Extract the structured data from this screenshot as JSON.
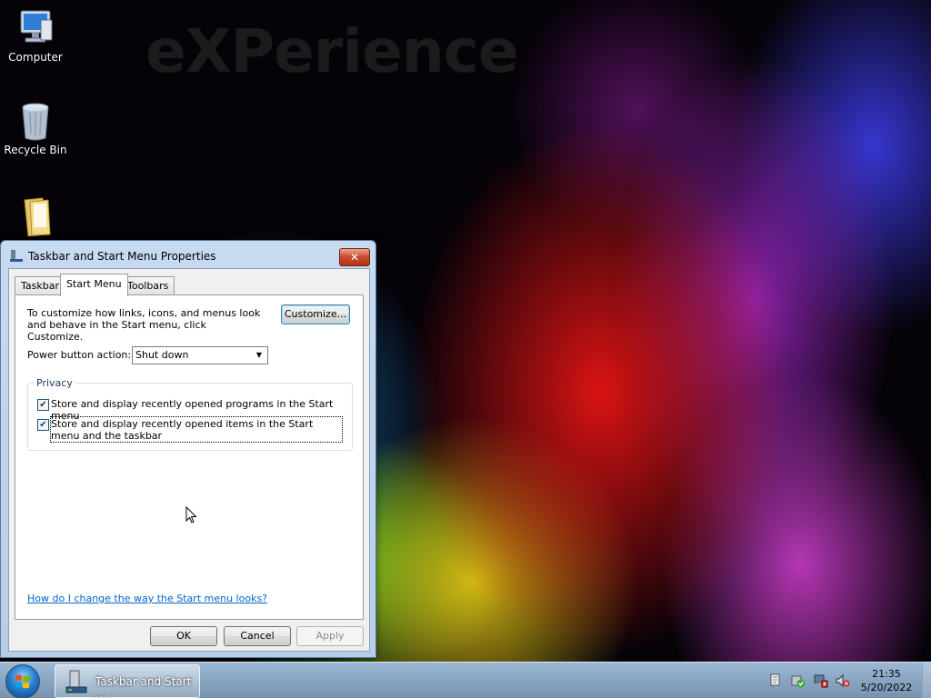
{
  "wallpaper": {
    "text": "eXPerience"
  },
  "desktop_icons": [
    {
      "label": "Computer",
      "icon": "computer-icon"
    },
    {
      "label": "Recycle Bin",
      "icon": "recycle-bin-icon"
    },
    {
      "label": "",
      "icon": "folder-icon"
    }
  ],
  "dialog": {
    "title": "Taskbar and Start Menu Properties",
    "close_label": "✕",
    "tabs": [
      {
        "label": "Taskbar",
        "active": false
      },
      {
        "label": "Start Menu",
        "active": true
      },
      {
        "label": "Toolbars",
        "active": false
      }
    ],
    "description": "To customize how links, icons, and menus look and behave in the Start menu, click Customize.",
    "customize_label": "Customize...",
    "power_label": "Power button action:",
    "power_value": "Shut down",
    "privacy": {
      "title": "Privacy",
      "items": [
        {
          "label": "Store and display recently opened programs in the Start menu",
          "checked": true
        },
        {
          "label": "Store and display recently opened items in the Start menu and the taskbar",
          "checked": true
        }
      ]
    },
    "help_link": "How do I change the way the Start menu looks?",
    "ok_label": "OK",
    "cancel_label": "Cancel",
    "apply_label": "Apply"
  },
  "taskbar": {
    "task_label": "Taskbar and Start ...",
    "clock_time": "21:35",
    "clock_date": "5/20/2022",
    "tray_icons": [
      "action-center-icon",
      "security-shield-icon",
      "network-icon",
      "volume-muted-icon"
    ]
  },
  "colors": {
    "link": "#0066cc",
    "close_button": "#c84a2c"
  }
}
